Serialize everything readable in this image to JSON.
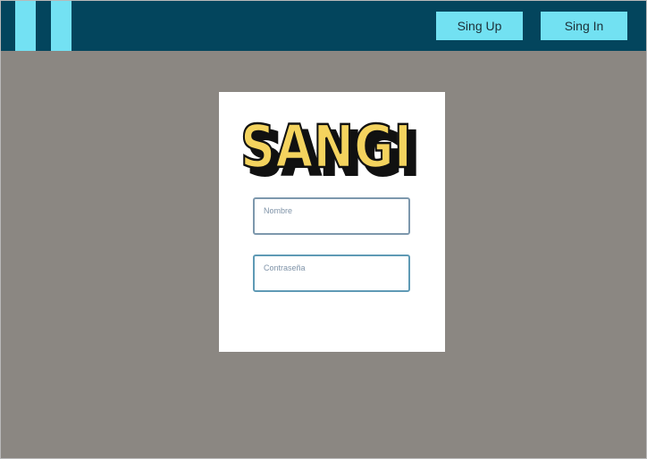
{
  "colors": {
    "navbar": "#03455d",
    "accent": "#72e1f2",
    "background": "#8b8782",
    "card": "#ffffff",
    "logo_yellow": "#f4d35e",
    "logo_black": "#111111"
  },
  "navbar": {
    "signup_label": "Sing Up",
    "signin_label": "Sing In"
  },
  "logo": {
    "text": "SANGI"
  },
  "form": {
    "name_label": "Nombre",
    "name_value": "",
    "password_label": "Contraseña",
    "password_value": ""
  }
}
